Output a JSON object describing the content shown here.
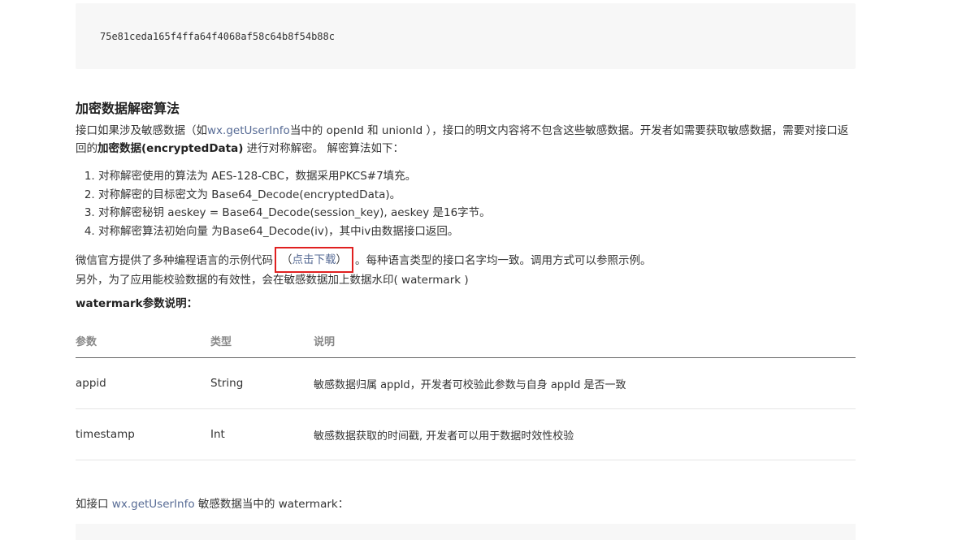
{
  "code_block": {
    "hash": "75e81ceda165f4ffa64f4068af58c64b8f54b88c"
  },
  "section": {
    "title": "加密数据解密算法"
  },
  "intro": {
    "p1_a": "接口如果涉及敏感数据（如",
    "p1_link": "wx.getUserInfo",
    "p1_b": "当中的 openId 和 unionId ），接口的明文内容将不包含这些敏感数据。开发者如需要获取敏感数据，需要对接口返回的",
    "p1_bold": "加密数据(encryptedData)",
    "p1_c": " 进行对称解密。 解密算法如下："
  },
  "steps": [
    "对称解密使用的算法为 AES-128-CBC，数据采用PKCS#7填充。",
    "对称解密的目标密文为 Base64_Decode(encryptedData)。",
    "对称解密秘钥 aeskey = Base64_Decode(session_key), aeskey 是16字节。",
    "对称解密算法初始向量 为Base64_Decode(iv)，其中iv由数据接口返回。"
  ],
  "sample": {
    "text_a": "微信官方提供了多种编程语言的示例代码",
    "open_paren": "（",
    "download_link": "点击下载",
    "close_paren": "）",
    "text_b": "。每种语言类型的接口名字均一致。调用方式可以参照示例。"
  },
  "watermark_note": "另外，为了应用能校验数据的有效性，会在敏感数据加上数据水印( watermark )",
  "watermark_heading": "watermark参数说明：",
  "table": {
    "headers": [
      "参数",
      "类型",
      "说明"
    ],
    "rows": [
      {
        "param": "appid",
        "type": "String",
        "desc": "敏感数据归属 appId，开发者可校验此参数与自身 appId 是否一致"
      },
      {
        "param": "timestamp",
        "type": "Int",
        "desc": "敏感数据获取的时间戳, 开发者可以用于数据时效性校验"
      }
    ]
  },
  "example": {
    "text_a": "如接口 ",
    "link": "wx.getUserInfo",
    "text_b": " 敏感数据当中的 watermark："
  },
  "colors": {
    "link": "#576b95",
    "highlight_box": "#e02020",
    "code_bg": "#f7f7f7"
  }
}
